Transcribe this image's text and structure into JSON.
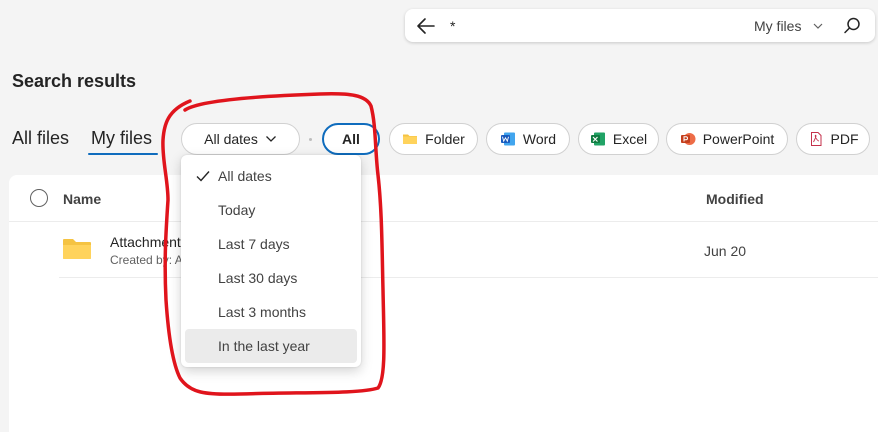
{
  "search": {
    "query": "*",
    "scope": "My files"
  },
  "page": {
    "title": "Search results"
  },
  "tabs": [
    {
      "label": "All files"
    },
    {
      "label": "My files"
    }
  ],
  "filters": {
    "date": "All dates",
    "types": [
      {
        "label": "All",
        "icon": "none"
      },
      {
        "label": "Folder",
        "icon": "folder-icon"
      },
      {
        "label": "Word",
        "icon": "word-icon"
      },
      {
        "label": "Excel",
        "icon": "excel-icon"
      },
      {
        "label": "PowerPoint",
        "icon": "powerpoint-icon"
      },
      {
        "label": "PDF",
        "icon": "pdf-icon"
      }
    ]
  },
  "table": {
    "columns": {
      "name": "Name",
      "modified": "Modified"
    },
    "rows": [
      {
        "name": "Attachment",
        "subtitle": "Created by: A",
        "modified": "Jun 20"
      }
    ]
  },
  "date_menu": {
    "items": [
      {
        "label": "All dates",
        "checked": true
      },
      {
        "label": "Today"
      },
      {
        "label": "Last 7 days"
      },
      {
        "label": "Last 30 days"
      },
      {
        "label": "Last 3 months"
      },
      {
        "label": "In the last year",
        "hovered": true
      }
    ]
  },
  "colors": {
    "accent": "#0f6cbd",
    "annotation": "#e0141c",
    "folder": "#f5c342",
    "word": "#185abd",
    "excel": "#107c41",
    "powerpoint": "#c43e1c"
  }
}
